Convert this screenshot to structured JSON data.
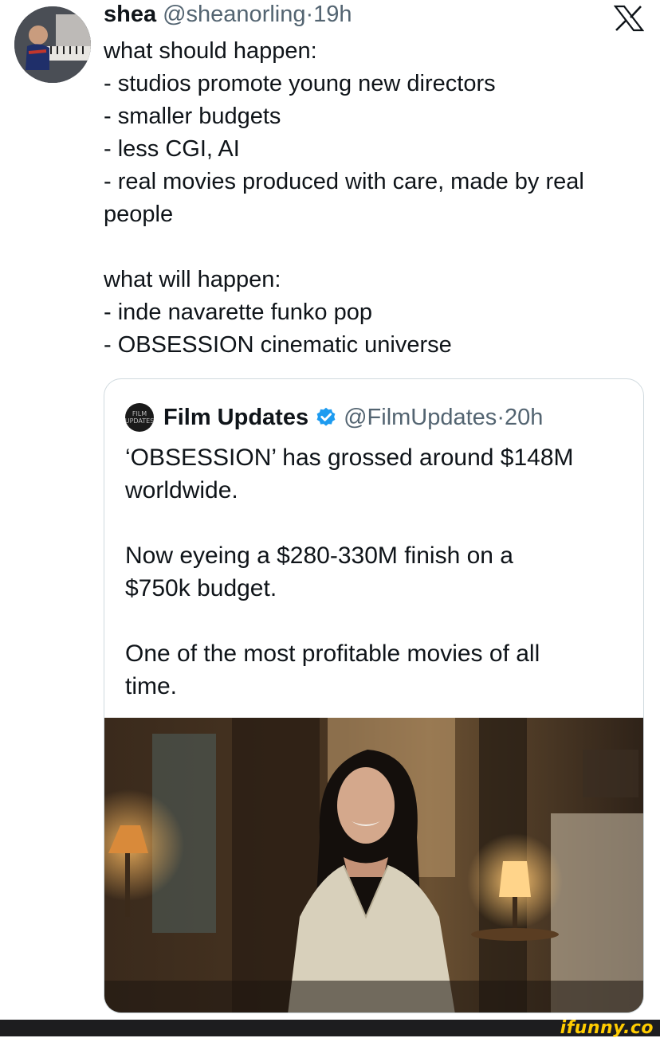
{
  "tweet": {
    "author_name": "shea",
    "author_handle": "@sheanorling",
    "separator": "·",
    "time": "19h",
    "lines": [
      "what should happen:",
      "- studios promote young new directors",
      "- smaller budgets",
      "- less CGI, AI",
      "- real movies produced with care, made by real",
      "people",
      "",
      "what will happen:",
      "- inde navarette funko pop",
      "- OBSESSION cinematic universe"
    ]
  },
  "quote": {
    "avatar_text_1": "FILM",
    "avatar_text_2": "UPDATES",
    "author_name": "Film Updates",
    "author_handle": "@FilmUpdates",
    "separator": "·",
    "time": "20h",
    "lines": [
      "‘OBSESSION’ has grossed around $148M",
      "worldwide.",
      "",
      "Now eyeing a $280-330M finish on a",
      "$750k budget.",
      "",
      "One of the most profitable movies of all",
      "time."
    ]
  },
  "watermark": "ifunny.co",
  "colors": {
    "text": "#0f1419",
    "muted": "#536471",
    "border": "#cfd9de",
    "verified": "#1d9bf0",
    "watermark": "#ffcc00"
  },
  "icons": {
    "platform": "x-logo-icon",
    "verified": "verified-badge-icon"
  }
}
